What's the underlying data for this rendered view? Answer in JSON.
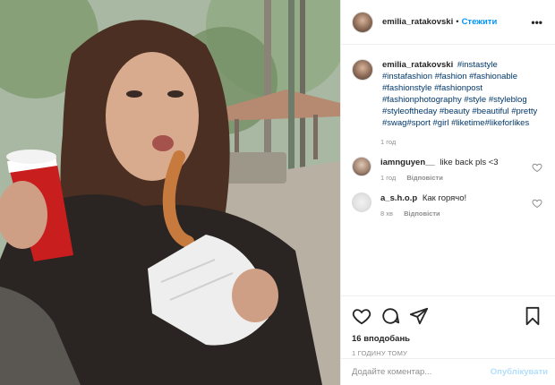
{
  "header": {
    "username": "emilia_ratakovski",
    "separator": "•",
    "follow_label": "Стежити",
    "more_label": "•••",
    "avatar_icon": "profile-avatar"
  },
  "caption": {
    "username": "emilia_ratakovski",
    "tags_line": "#instastyle #instafashion #fashion #fashionable #fashionstyle #fashionpost #fashionphotography #style #styleblog #styleoftheday #beauty #beautiful #pretty #swag#sport #girl #liketime#likeforlikes",
    "time": "1 год"
  },
  "comments": [
    {
      "username": "iamnguyen__",
      "text": "like back pls <3",
      "time": "1 год",
      "reply_label": "Відповісти"
    },
    {
      "username": "a_s.h.o.p",
      "text": "Как горячо!",
      "time": "8 хв",
      "reply_label": "Відповісти"
    }
  ],
  "actions": {
    "likes": "16 вподобань",
    "posted_ago": "1 ГОДИНУ ТОМУ",
    "icons": [
      "heart-icon",
      "comment-icon",
      "share-icon",
      "bookmark-icon"
    ]
  },
  "add_comment": {
    "placeholder": "Додайте коментар...",
    "post_label": "Опублікувати"
  },
  "colors": {
    "link": "#00376b",
    "follow": "#0095f6",
    "post_button_disabled": "#b2dffc",
    "muted": "#8e8e8e"
  }
}
